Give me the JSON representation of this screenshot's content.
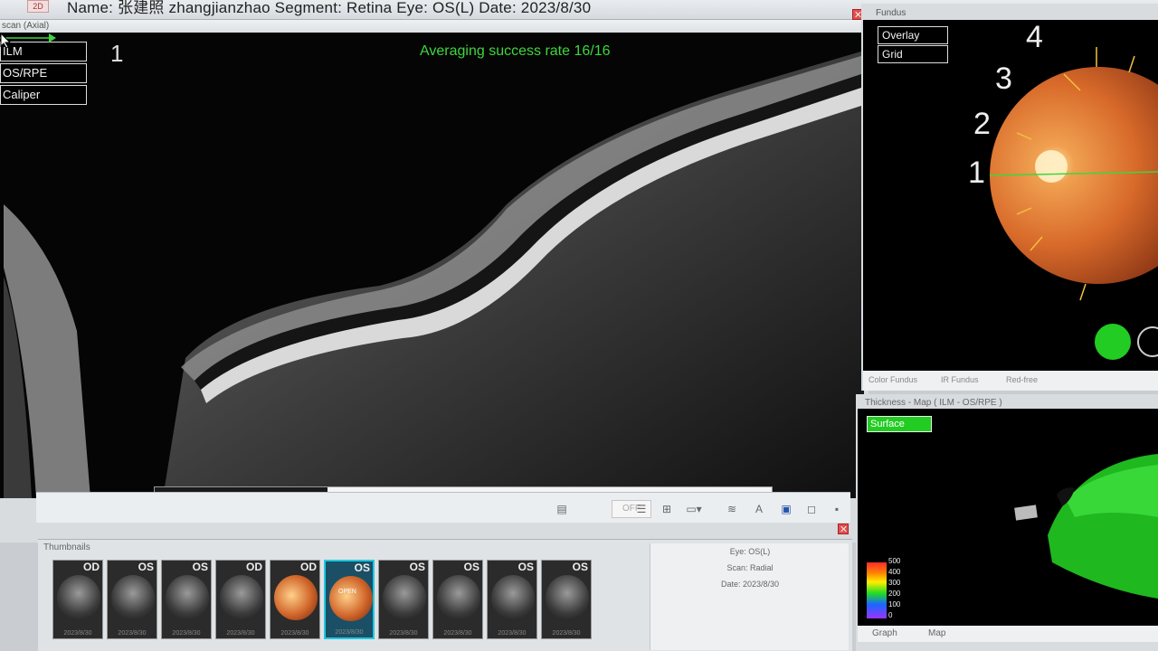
{
  "header": {
    "mode_tab": "2D",
    "patient_line": "Name: 张建照 zhangjianzhao  Segment: Retina  Eye: OS(L)  Date: 2023/8/30"
  },
  "scan": {
    "title": "scan (Axial)",
    "layers": [
      "ILM",
      "OS/RPE",
      "Caliper"
    ],
    "frame_number": "1",
    "averaging_text": "Averaging success rate  16/16",
    "progress_fraction": 0.28,
    "toolbar_off": "OFF"
  },
  "thumbnails": {
    "title": "Thumbnails",
    "items": [
      {
        "eye": "OD",
        "date": "2023/8/30",
        "kind": "oct"
      },
      {
        "eye": "OS",
        "date": "2023/8/30",
        "kind": "oct"
      },
      {
        "eye": "OS",
        "date": "2023/8/30",
        "kind": "oct"
      },
      {
        "eye": "OD",
        "date": "2023/8/30",
        "kind": "oct"
      },
      {
        "eye": "OD",
        "date": "2023/8/30",
        "kind": "fundus"
      },
      {
        "eye": "OS",
        "date": "2023/8/30",
        "kind": "fundus-open",
        "selected": true
      },
      {
        "eye": "OS",
        "date": "2023/8/30",
        "kind": "oct"
      },
      {
        "eye": "OS",
        "date": "2023/8/30",
        "kind": "oct"
      },
      {
        "eye": "OS",
        "date": "2023/8/30",
        "kind": "oct"
      },
      {
        "eye": "OS",
        "date": "2023/8/30",
        "kind": "oct"
      }
    ],
    "open_label": "OPEN",
    "info": {
      "eye": "Eye: OS(L)",
      "scan": "Scan: Radial",
      "date": "Date: 2023/8/30"
    }
  },
  "fundus": {
    "title": "Fundus",
    "buttons": [
      "Overlay",
      "Grid"
    ],
    "grid_numbers": [
      "4",
      "3",
      "2",
      "1"
    ],
    "tabs": [
      "Color Fundus",
      "IR Fundus",
      "Red-free"
    ]
  },
  "thickness": {
    "title": "Thickness - Map  ( ILM - OS/RPE )",
    "surface_label": "Surface",
    "scale_labels": [
      "500",
      "400",
      "300",
      "200",
      "100",
      "0"
    ],
    "tabs": [
      "Graph",
      "Map"
    ]
  },
  "colors": {
    "accent_green": "#3ed63e",
    "selected_thumb": "#21c8e0",
    "close_red": "#e05050"
  }
}
